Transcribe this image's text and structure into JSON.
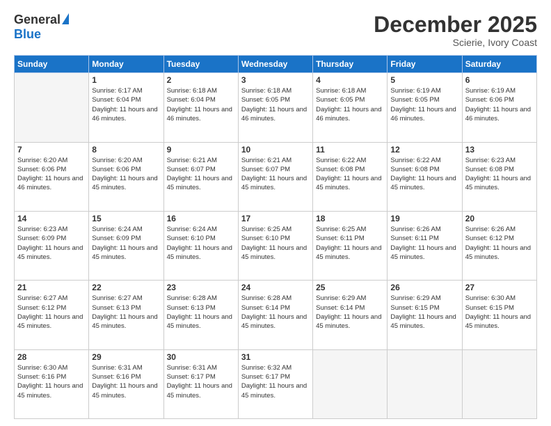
{
  "header": {
    "logo_line1": "General",
    "logo_line2": "Blue",
    "month": "December 2025",
    "location": "Scierie, Ivory Coast"
  },
  "days_of_week": [
    "Sunday",
    "Monday",
    "Tuesday",
    "Wednesday",
    "Thursday",
    "Friday",
    "Saturday"
  ],
  "weeks": [
    [
      {
        "day": "",
        "info": ""
      },
      {
        "day": "1",
        "info": "Sunrise: 6:17 AM\nSunset: 6:04 PM\nDaylight: 11 hours and 46 minutes."
      },
      {
        "day": "2",
        "info": "Sunrise: 6:18 AM\nSunset: 6:04 PM\nDaylight: 11 hours and 46 minutes."
      },
      {
        "day": "3",
        "info": "Sunrise: 6:18 AM\nSunset: 6:05 PM\nDaylight: 11 hours and 46 minutes."
      },
      {
        "day": "4",
        "info": "Sunrise: 6:18 AM\nSunset: 6:05 PM\nDaylight: 11 hours and 46 minutes."
      },
      {
        "day": "5",
        "info": "Sunrise: 6:19 AM\nSunset: 6:05 PM\nDaylight: 11 hours and 46 minutes."
      },
      {
        "day": "6",
        "info": "Sunrise: 6:19 AM\nSunset: 6:06 PM\nDaylight: 11 hours and 46 minutes."
      }
    ],
    [
      {
        "day": "7",
        "info": "Sunrise: 6:20 AM\nSunset: 6:06 PM\nDaylight: 11 hours and 46 minutes."
      },
      {
        "day": "8",
        "info": "Sunrise: 6:20 AM\nSunset: 6:06 PM\nDaylight: 11 hours and 45 minutes."
      },
      {
        "day": "9",
        "info": "Sunrise: 6:21 AM\nSunset: 6:07 PM\nDaylight: 11 hours and 45 minutes."
      },
      {
        "day": "10",
        "info": "Sunrise: 6:21 AM\nSunset: 6:07 PM\nDaylight: 11 hours and 45 minutes."
      },
      {
        "day": "11",
        "info": "Sunrise: 6:22 AM\nSunset: 6:08 PM\nDaylight: 11 hours and 45 minutes."
      },
      {
        "day": "12",
        "info": "Sunrise: 6:22 AM\nSunset: 6:08 PM\nDaylight: 11 hours and 45 minutes."
      },
      {
        "day": "13",
        "info": "Sunrise: 6:23 AM\nSunset: 6:08 PM\nDaylight: 11 hours and 45 minutes."
      }
    ],
    [
      {
        "day": "14",
        "info": "Sunrise: 6:23 AM\nSunset: 6:09 PM\nDaylight: 11 hours and 45 minutes."
      },
      {
        "day": "15",
        "info": "Sunrise: 6:24 AM\nSunset: 6:09 PM\nDaylight: 11 hours and 45 minutes."
      },
      {
        "day": "16",
        "info": "Sunrise: 6:24 AM\nSunset: 6:10 PM\nDaylight: 11 hours and 45 minutes."
      },
      {
        "day": "17",
        "info": "Sunrise: 6:25 AM\nSunset: 6:10 PM\nDaylight: 11 hours and 45 minutes."
      },
      {
        "day": "18",
        "info": "Sunrise: 6:25 AM\nSunset: 6:11 PM\nDaylight: 11 hours and 45 minutes."
      },
      {
        "day": "19",
        "info": "Sunrise: 6:26 AM\nSunset: 6:11 PM\nDaylight: 11 hours and 45 minutes."
      },
      {
        "day": "20",
        "info": "Sunrise: 6:26 AM\nSunset: 6:12 PM\nDaylight: 11 hours and 45 minutes."
      }
    ],
    [
      {
        "day": "21",
        "info": "Sunrise: 6:27 AM\nSunset: 6:12 PM\nDaylight: 11 hours and 45 minutes."
      },
      {
        "day": "22",
        "info": "Sunrise: 6:27 AM\nSunset: 6:13 PM\nDaylight: 11 hours and 45 minutes."
      },
      {
        "day": "23",
        "info": "Sunrise: 6:28 AM\nSunset: 6:13 PM\nDaylight: 11 hours and 45 minutes."
      },
      {
        "day": "24",
        "info": "Sunrise: 6:28 AM\nSunset: 6:14 PM\nDaylight: 11 hours and 45 minutes."
      },
      {
        "day": "25",
        "info": "Sunrise: 6:29 AM\nSunset: 6:14 PM\nDaylight: 11 hours and 45 minutes."
      },
      {
        "day": "26",
        "info": "Sunrise: 6:29 AM\nSunset: 6:15 PM\nDaylight: 11 hours and 45 minutes."
      },
      {
        "day": "27",
        "info": "Sunrise: 6:30 AM\nSunset: 6:15 PM\nDaylight: 11 hours and 45 minutes."
      }
    ],
    [
      {
        "day": "28",
        "info": "Sunrise: 6:30 AM\nSunset: 6:16 PM\nDaylight: 11 hours and 45 minutes."
      },
      {
        "day": "29",
        "info": "Sunrise: 6:31 AM\nSunset: 6:16 PM\nDaylight: 11 hours and 45 minutes."
      },
      {
        "day": "30",
        "info": "Sunrise: 6:31 AM\nSunset: 6:17 PM\nDaylight: 11 hours and 45 minutes."
      },
      {
        "day": "31",
        "info": "Sunrise: 6:32 AM\nSunset: 6:17 PM\nDaylight: 11 hours and 45 minutes."
      },
      {
        "day": "",
        "info": ""
      },
      {
        "day": "",
        "info": ""
      },
      {
        "day": "",
        "info": ""
      }
    ]
  ]
}
